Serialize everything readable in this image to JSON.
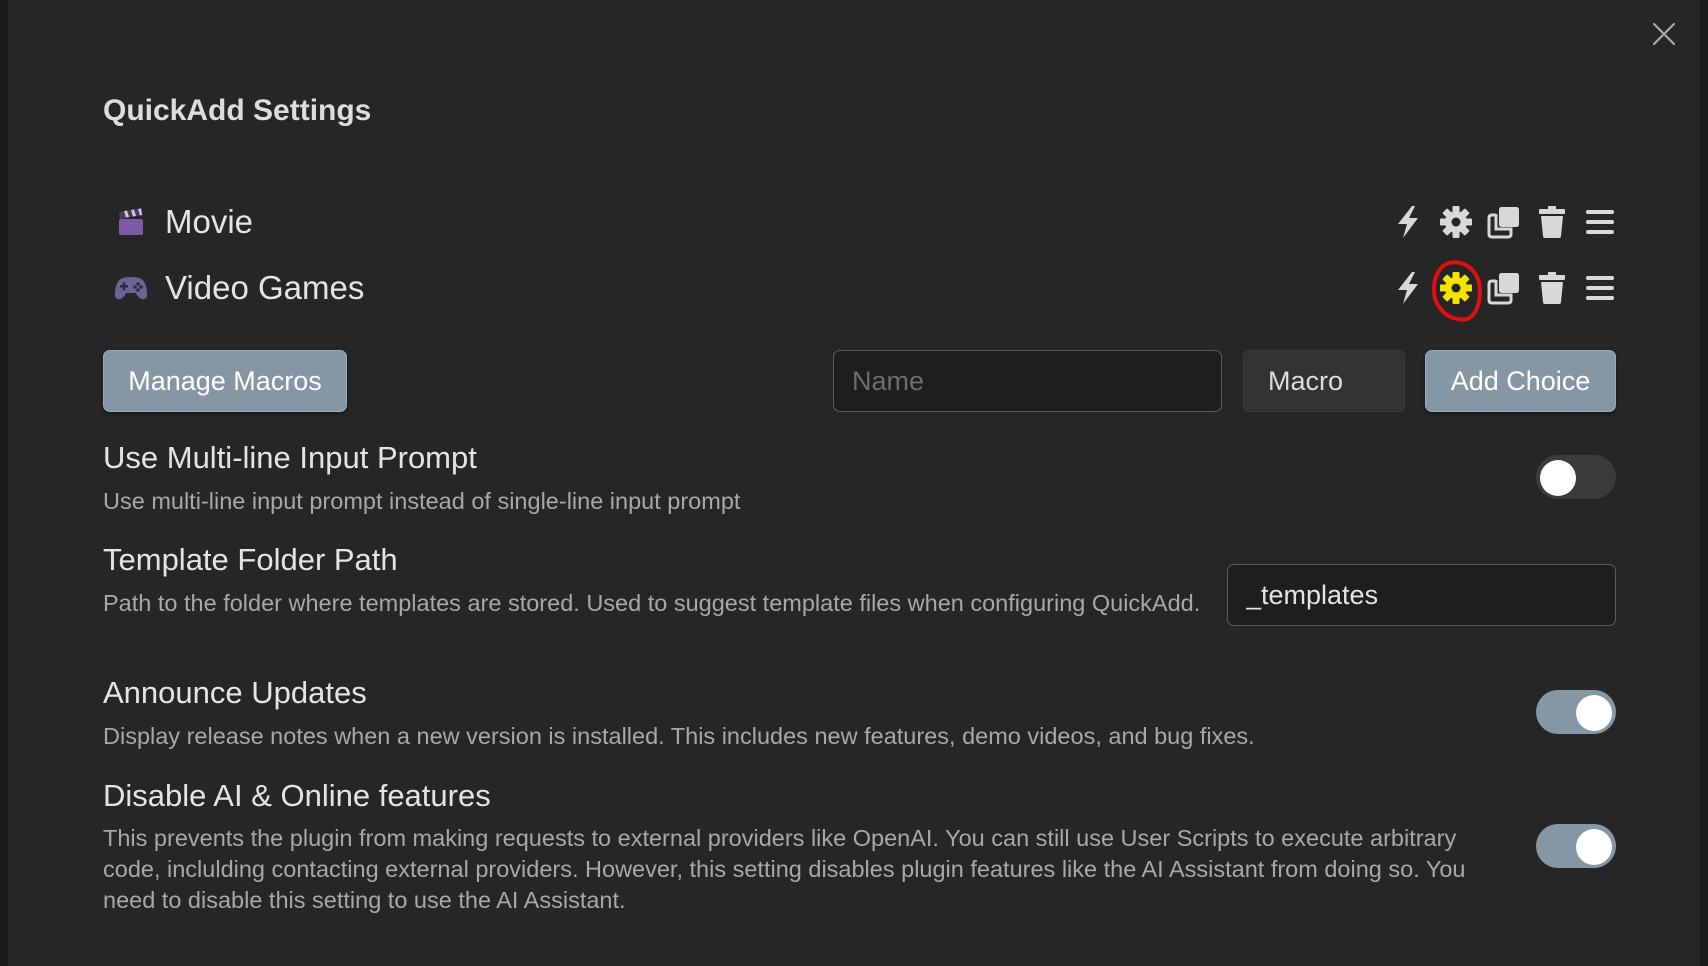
{
  "title": "QuickAdd Settings",
  "choices": [
    {
      "name": "Movie",
      "emoji": "clapper-board-icon"
    },
    {
      "name": "Video Games",
      "emoji": "game-controller-icon"
    }
  ],
  "actions": {
    "manage_macros_label": "Manage Macros",
    "name_placeholder": "Name",
    "type_selected": "Macro",
    "add_choice_label": "Add Choice"
  },
  "settings": {
    "multiline": {
      "name": "Use Multi-line Input Prompt",
      "desc": "Use multi-line input prompt instead of single-line input prompt",
      "enabled": false
    },
    "template_path": {
      "name": "Template Folder Path",
      "desc": "Path to the folder where templates are stored. Used to suggest template files when configuring QuickAdd.",
      "value": "_templates"
    },
    "announce": {
      "name": "Announce Updates",
      "desc": "Display release notes when a new version is installed. This includes new features, demo videos, and bug fixes.",
      "enabled": true
    },
    "disable_ai": {
      "name": "Disable AI & Online features",
      "desc": "This prevents the plugin from making requests to external providers like OpenAI. You can still use User Scripts to execute arbitrary code, inclulding contacting external providers. However, this setting disables plugin features like the AI Assistant from doing so. You need to disable this setting to use the AI Assistant.",
      "enabled": true
    }
  },
  "colors": {
    "accent": "#8597a5",
    "highlight_gear": "#f5e400",
    "annotation": "#e30e0e"
  }
}
